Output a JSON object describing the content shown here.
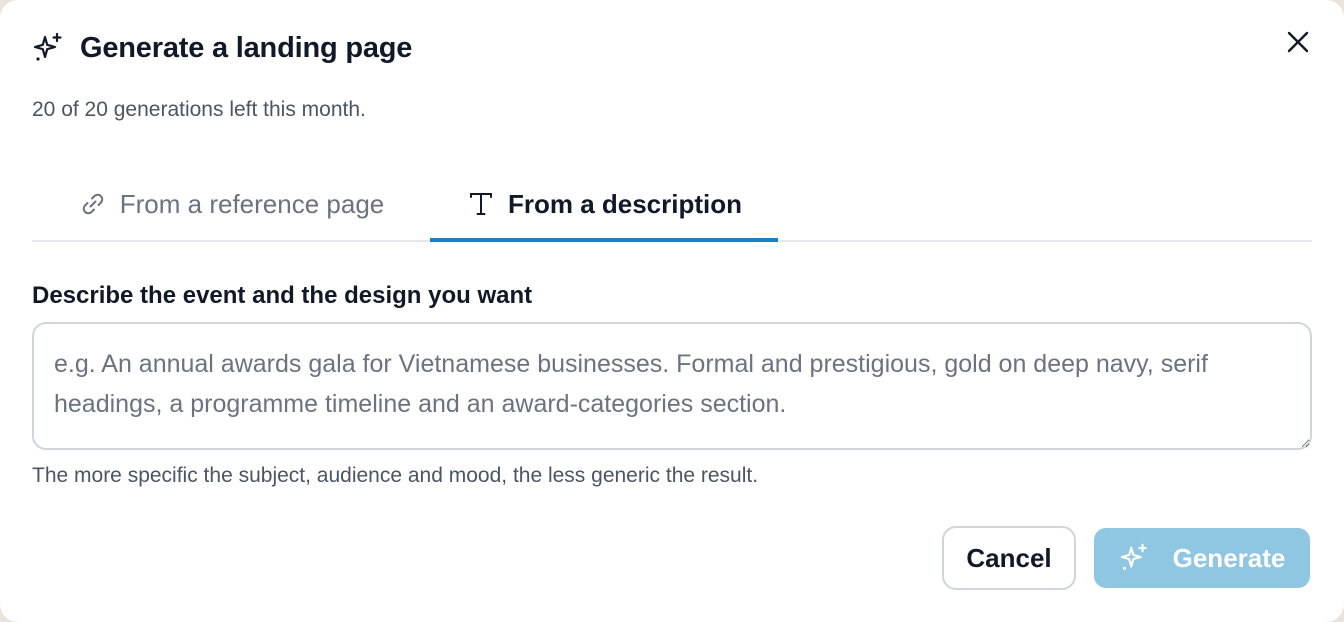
{
  "dialog": {
    "title": "Generate a landing page",
    "subtitle": "20 of 20 generations left this month.",
    "title_icon": "sparkles-icon",
    "close_icon": "close-icon"
  },
  "tabs": [
    {
      "label": "From a reference page",
      "icon": "link-icon",
      "active": false
    },
    {
      "label": "From a description",
      "icon": "text-icon",
      "active": true
    }
  ],
  "description_field": {
    "label": "Describe the event and the design you want",
    "value": "",
    "placeholder": "e.g. An annual awards gala for Vietnamese businesses. Formal and prestigious, gold on deep navy, serif headings, a programme timeline and an award-categories section.",
    "helper": "The more specific the subject, audience and mood, the less generic the result."
  },
  "actions": {
    "cancel_label": "Cancel",
    "generate_label": "Generate",
    "generate_icon": "sparkles-icon",
    "generate_disabled": true
  },
  "colors": {
    "accent": "#1a82c2",
    "generate_disabled_bg": "#8fc6e1",
    "text_primary": "#111827",
    "text_secondary": "#4b5563",
    "border": "#d1d5db"
  }
}
